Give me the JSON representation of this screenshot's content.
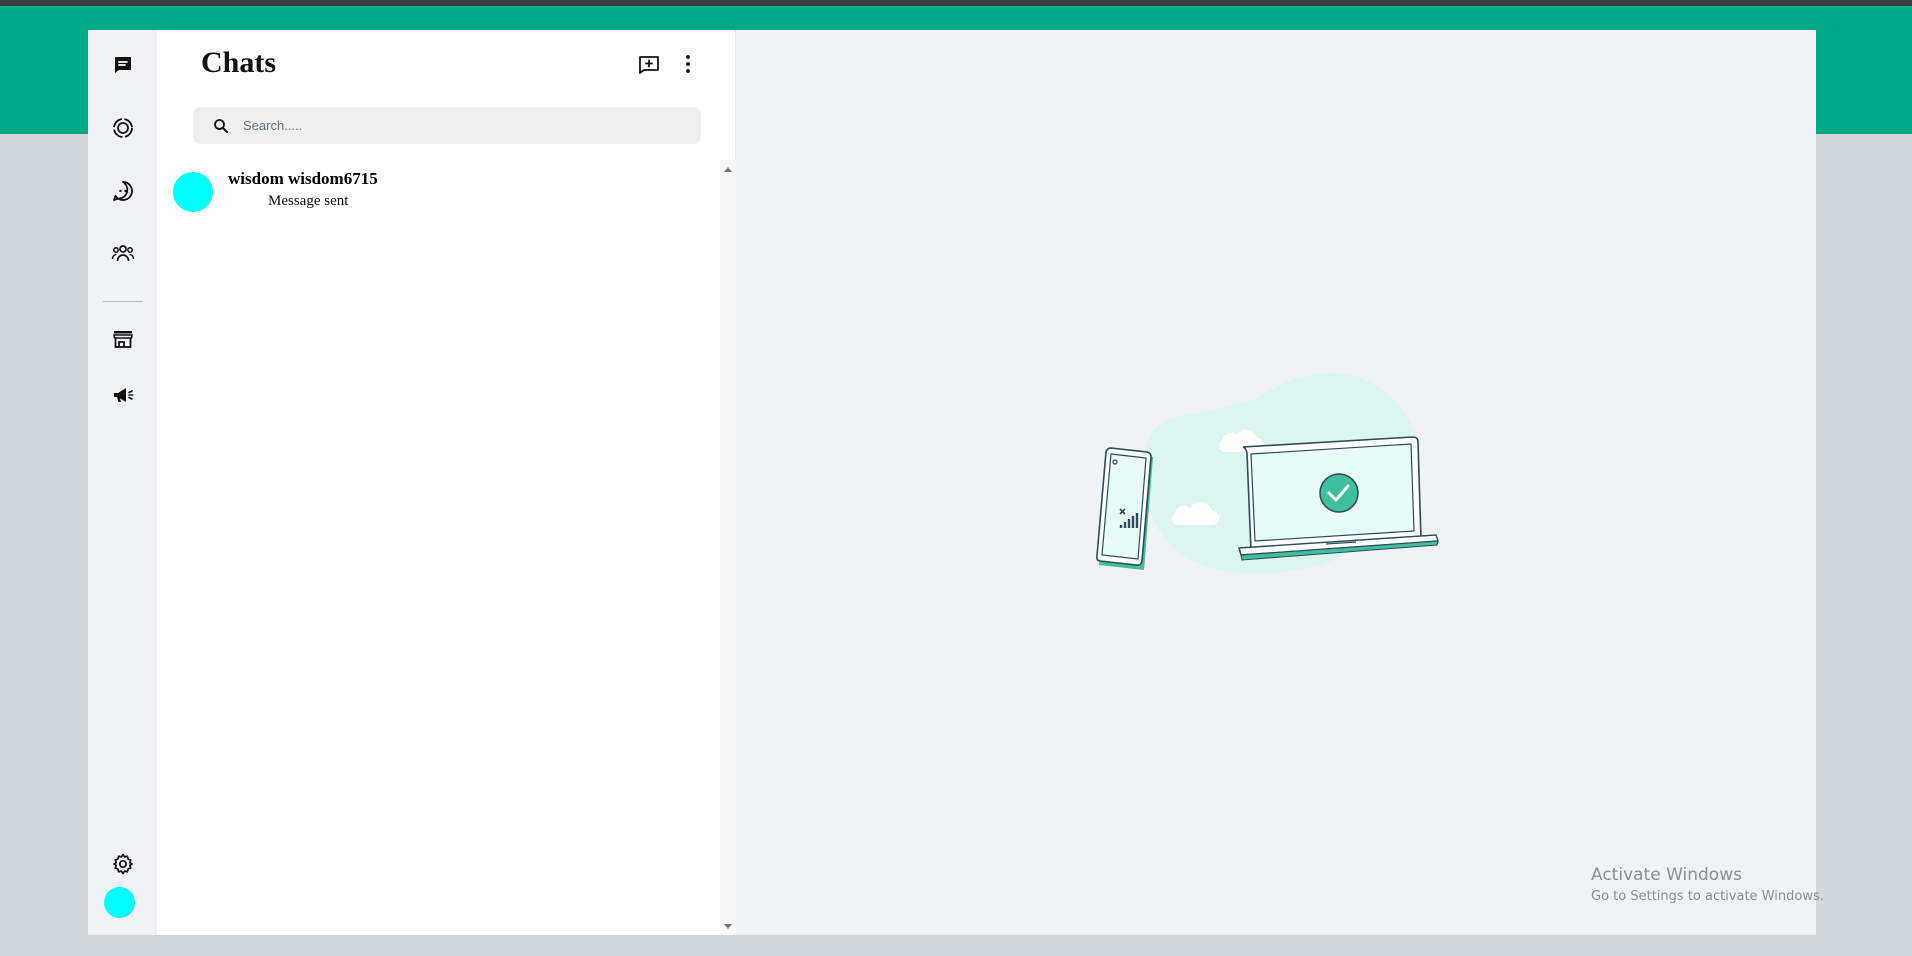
{
  "app": {
    "banner_color": "#00a884",
    "accent_color": "#00ffff"
  },
  "rail": {
    "icons": [
      "chats-icon",
      "status-icon",
      "channels-icon",
      "communities-icon",
      "store-icon",
      "announcements-icon",
      "settings-icon"
    ]
  },
  "chatlist": {
    "title": "Chats",
    "search_placeholder": "Search.....",
    "chats": [
      {
        "name": "wisdom wisdom6715",
        "preview": "Message sent"
      }
    ]
  },
  "watermark": {
    "title": "Activate Windows",
    "subtitle": "Go to Settings to activate Windows."
  }
}
